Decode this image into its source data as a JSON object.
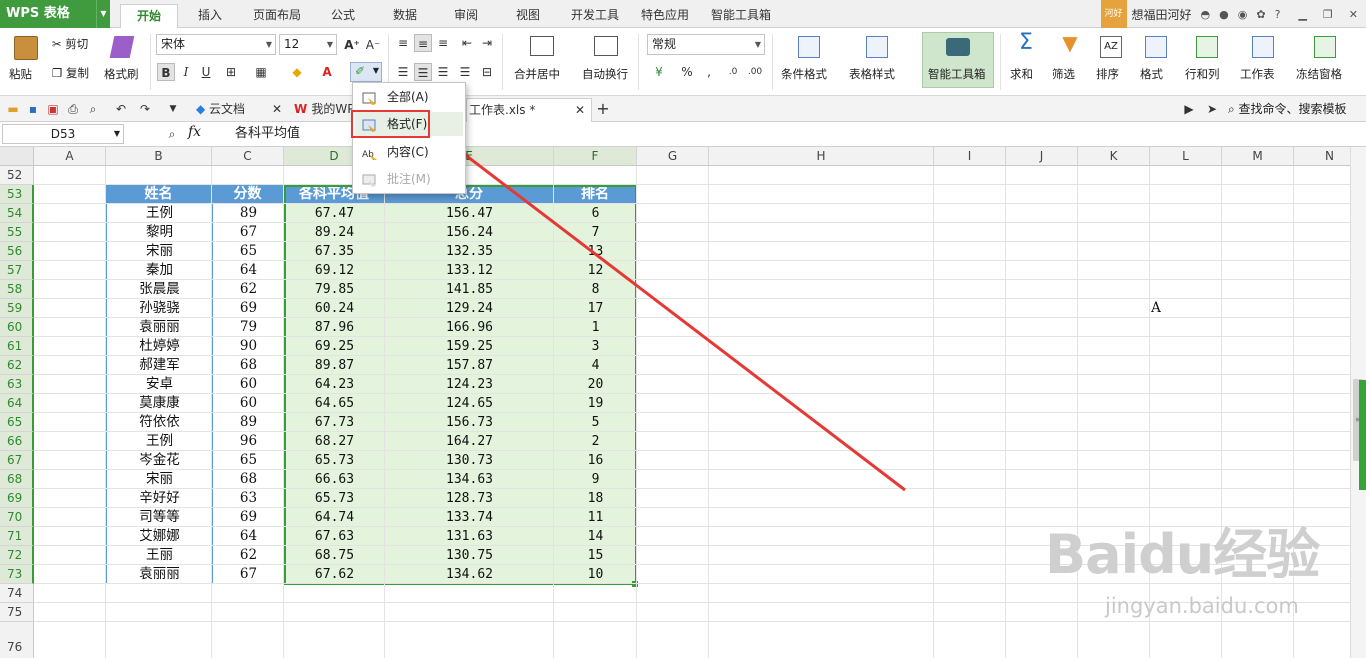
{
  "app": {
    "logo": "WPS 表格"
  },
  "menu": {
    "tabs": [
      "开始",
      "插入",
      "页面布局",
      "公式",
      "数据",
      "审阅",
      "视图",
      "开发工具",
      "特色应用",
      "智能工具箱"
    ],
    "active": "开始"
  },
  "user": {
    "badge": "河好",
    "name": "想福田河好"
  },
  "ribbon": {
    "paste": "粘贴",
    "cut": "剪切",
    "copy": "复制",
    "format_painter": "格式刷",
    "font_name": "宋体",
    "font_size": "12",
    "bold": "B",
    "italic": "I",
    "underline": "U",
    "merge": "合并居中",
    "wrap": "自动换行",
    "number_format": "常规",
    "percent": "%",
    "cond_format": "条件格式",
    "table_style": "表格样式",
    "smart_toolbox": "智能工具箱",
    "sum": "求和",
    "filter": "筛选",
    "sort": "排序",
    "format": "格式",
    "row_col": "行和列",
    "worksheet": "工作表",
    "freeze": "冻结窗格"
  },
  "doc_tabs": [
    "云文档",
    "我的WP",
    "工作表.xls *"
  ],
  "search_cmd": "查找命令、搜索模板",
  "formula_bar": {
    "name_box": "D53",
    "fx": "fx",
    "formula": "各科平均值"
  },
  "columns": [
    "A",
    "B",
    "C",
    "D",
    "E",
    "F",
    "G",
    "H",
    "I",
    "J",
    "K",
    "L",
    "M",
    "N"
  ],
  "table": {
    "headers": [
      "姓名",
      "分数",
      "各科平均值",
      "总分",
      "排名"
    ],
    "rows": [
      [
        "王例",
        "89",
        "67.47",
        "156.47",
        "6"
      ],
      [
        "黎明",
        "67",
        "89.24",
        "156.24",
        "7"
      ],
      [
        "宋丽",
        "65",
        "67.35",
        "132.35",
        "13"
      ],
      [
        "秦加",
        "64",
        "69.12",
        "133.12",
        "12"
      ],
      [
        "张晨晨",
        "62",
        "79.85",
        "141.85",
        "8"
      ],
      [
        "孙骁骁",
        "69",
        "60.24",
        "129.24",
        "17"
      ],
      [
        "袁丽丽",
        "79",
        "87.96",
        "166.96",
        "1"
      ],
      [
        "杜婷婷",
        "90",
        "69.25",
        "159.25",
        "3"
      ],
      [
        "郝建军",
        "68",
        "89.87",
        "157.87",
        "4"
      ],
      [
        "安卓",
        "60",
        "64.23",
        "124.23",
        "20"
      ],
      [
        "莫康康",
        "60",
        "64.65",
        "124.65",
        "19"
      ],
      [
        "符依依",
        "89",
        "67.73",
        "156.73",
        "5"
      ],
      [
        "王例",
        "96",
        "68.27",
        "164.27",
        "2"
      ],
      [
        "岑金花",
        "65",
        "65.73",
        "130.73",
        "16"
      ],
      [
        "宋丽",
        "68",
        "66.63",
        "134.63",
        "9"
      ],
      [
        "辛好好",
        "63",
        "65.73",
        "128.73",
        "18"
      ],
      [
        "司等等",
        "69",
        "64.74",
        "133.74",
        "11"
      ],
      [
        "艾娜娜",
        "64",
        "67.63",
        "131.63",
        "14"
      ],
      [
        "王丽",
        "62",
        "68.75",
        "130.75",
        "15"
      ],
      [
        "袁丽丽",
        "67",
        "67.62",
        "134.62",
        "10"
      ]
    ]
  },
  "row_numbers": [
    "52",
    "53",
    "54",
    "55",
    "56",
    "57",
    "58",
    "59",
    "60",
    "61",
    "62",
    "63",
    "64",
    "65",
    "66",
    "67",
    "68",
    "69",
    "70",
    "71",
    "72",
    "73",
    "74",
    "75",
    "76"
  ],
  "stray_cell": {
    "ref": "L59",
    "value": "A"
  },
  "dropdown": {
    "items": [
      {
        "label": "全部(A)",
        "enabled": true
      },
      {
        "label": "格式(F)",
        "enabled": true,
        "highlighted": true
      },
      {
        "label": "内容(C)",
        "enabled": true
      },
      {
        "label": "批注(M)",
        "enabled": false
      }
    ]
  },
  "watermark": {
    "main": "Baidu经验",
    "sub": "jingyan.baidu.com"
  },
  "colors": {
    "accent": "#3f9b3e",
    "header_fill": "#5b9bd5",
    "selection_fill": "#e4f3dc",
    "annotation": "#e53935"
  }
}
